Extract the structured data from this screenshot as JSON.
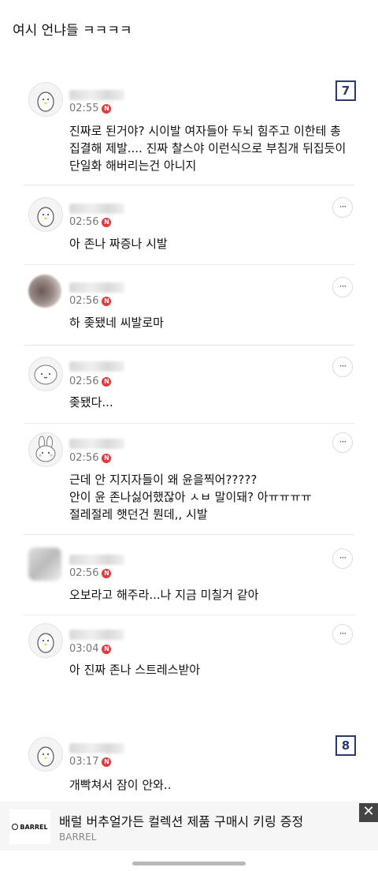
{
  "title": "여시 언냐들 ㅋㅋㅋㅋ",
  "comments": [
    {
      "time": "02:55",
      "badge": "N",
      "number": "7",
      "text": "진짜로 된거야? 시이발 여자들아 두뇌 힘주고 이한테 총\n집결해 제발.... 진짜 찰스야 이런식으로 부침개 뒤집듯이\n단일화 해버리는건 아니지"
    },
    {
      "time": "02:56",
      "badge": "N",
      "more": "···",
      "text": "아 존나 짜증나 시발"
    },
    {
      "time": "02:56",
      "badge": "N",
      "more": "···",
      "text": "하 좆됐네 씨발로마"
    },
    {
      "time": "02:56",
      "badge": "N",
      "more": "···",
      "text": "좆됐다..."
    },
    {
      "time": "02:56",
      "badge": "N",
      "more": "···",
      "text": "근데 안 지지자들이 왜 윤을찍어?????\n안이 윤 존나싫어했잖아 ㅅㅂ 말이돼? 아ㅠㅠㅠㅠ\n절레절레 햇던건 뭔데,, 시발"
    },
    {
      "time": "02:56",
      "badge": "N",
      "more": "···",
      "text": "오보라고 해주라...나 지금 미칠거 같아"
    },
    {
      "time": "03:04",
      "badge": "N",
      "more": "···",
      "text": "아 진짜 존나 스트레스받아"
    },
    {
      "time": "03:17",
      "badge": "N",
      "number": "8",
      "text": "개빡쳐서 잠이 안와.."
    }
  ],
  "ad": {
    "title": "배럴 버추얼가든 컬렉션 제품 구매시 키링 증정",
    "brand": "BARREL",
    "logo": "BARREL",
    "close": "✕"
  }
}
